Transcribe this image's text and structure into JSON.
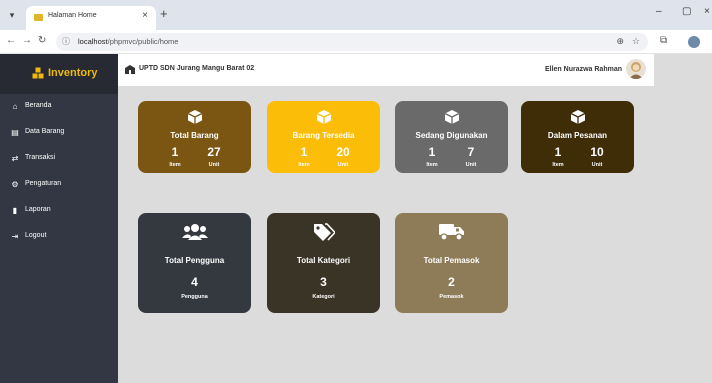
{
  "browser": {
    "tab_title": "Halaman Home",
    "url_host": "localhost",
    "url_path": "/phpmvc/public/home"
  },
  "sidebar": {
    "brand": "Inventory",
    "items": [
      {
        "label": "Beranda",
        "icon": "home-icon"
      },
      {
        "label": "Data Barang",
        "icon": "database-icon"
      },
      {
        "label": "Transaksi",
        "icon": "exchange-icon"
      },
      {
        "label": "Pengaturan",
        "icon": "cogs-icon"
      },
      {
        "label": "Laporan",
        "icon": "file-icon"
      },
      {
        "label": "Logout",
        "icon": "logout-icon"
      }
    ]
  },
  "topbar": {
    "school": "UPTD SDN Jurang Mangu Barat 02",
    "user": "Ellen Nurazwa Rahman"
  },
  "cards": [
    {
      "title": "Total Barang",
      "color": "#7a5612",
      "item_value": "1",
      "item_label": "Item",
      "unit_value": "27",
      "unit_label": "Unit",
      "icon": "box-icon"
    },
    {
      "title": "Barang Tersedia",
      "color": "#fbbd08",
      "item_value": "1",
      "item_label": "Item",
      "unit_value": "20",
      "unit_label": "Unit",
      "icon": "box-icon"
    },
    {
      "title": "Sedang Digunakan",
      "color": "#6a6a6a",
      "item_value": "1",
      "item_label": "Item",
      "unit_value": "7",
      "unit_label": "Unit",
      "icon": "box-icon"
    },
    {
      "title": "Dalam Pesanan",
      "color": "#3f2d08",
      "item_value": "1",
      "item_label": "Item",
      "unit_value": "10",
      "unit_label": "Unit",
      "icon": "box-icon"
    },
    {
      "title": "Total Pengguna",
      "color": "#34383f",
      "value": "4",
      "label": "Pengguna",
      "icon": "users-icon"
    },
    {
      "title": "Total Kategori",
      "color": "#3a3426",
      "value": "3",
      "label": "Kategori",
      "icon": "tags-icon"
    },
    {
      "title": "Total Pemasok",
      "color": "#8e7c58",
      "value": "2",
      "label": "Pemasok",
      "icon": "truck-icon"
    }
  ]
}
